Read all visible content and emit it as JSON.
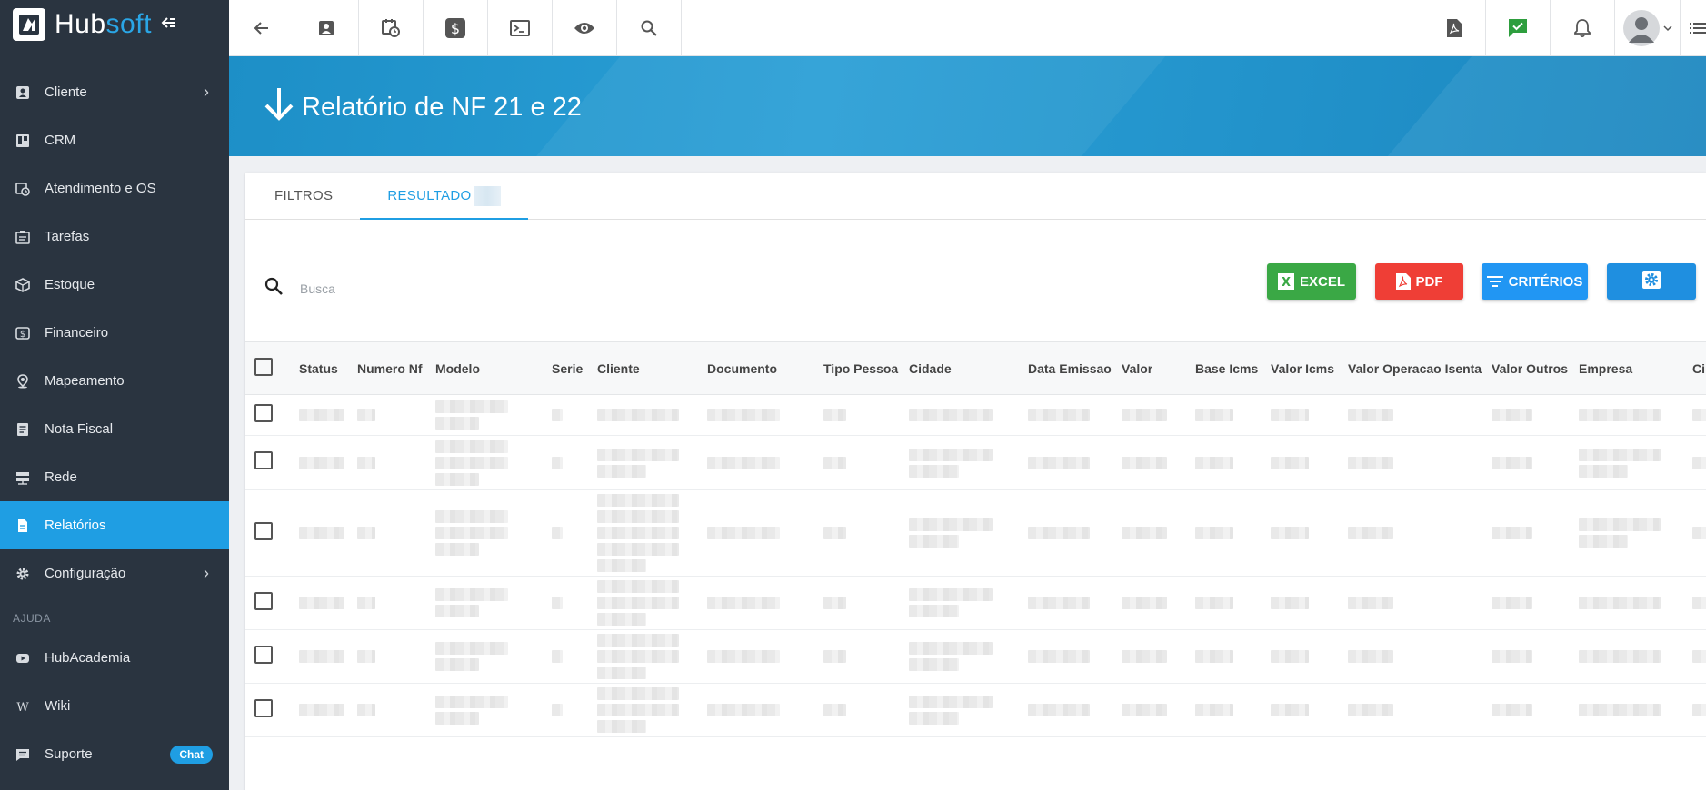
{
  "brand": {
    "part1": "Hub",
    "part2": "soft"
  },
  "sidebar": {
    "items": [
      {
        "label": "Cliente",
        "icon": "contact-card-icon",
        "chevron": true
      },
      {
        "label": "CRM",
        "icon": "kanban-icon",
        "chevron": false
      },
      {
        "label": "Atendimento e OS",
        "icon": "calendar-clock-icon",
        "chevron": false
      },
      {
        "label": "Tarefas",
        "icon": "task-board-icon",
        "chevron": false
      },
      {
        "label": "Estoque",
        "icon": "box-icon",
        "chevron": false
      },
      {
        "label": "Financeiro",
        "icon": "dollar-icon",
        "chevron": false
      },
      {
        "label": "Mapeamento",
        "icon": "map-pin-icon",
        "chevron": false
      },
      {
        "label": "Nota Fiscal",
        "icon": "receipt-icon",
        "chevron": false
      },
      {
        "label": "Rede",
        "icon": "server-icon",
        "chevron": false
      },
      {
        "label": "Relatórios",
        "icon": "document-icon",
        "chevron": false,
        "active": true
      },
      {
        "label": "Configuração",
        "icon": "gear-icon",
        "chevron": true
      }
    ],
    "section_label": "AJUDA",
    "help_items": [
      {
        "label": "HubAcademia",
        "icon": "play-icon"
      },
      {
        "label": "Wiki",
        "icon": "wiki-icon"
      },
      {
        "label": "Suporte",
        "icon": "chat-bubble-icon",
        "badge": "Chat"
      }
    ]
  },
  "page": {
    "title": "Relatório de NF 21 e 22"
  },
  "tabs": [
    {
      "label": "FILTROS",
      "active": false
    },
    {
      "label": "RESULTADO",
      "active": true
    }
  ],
  "search": {
    "placeholder": "Busca",
    "value": ""
  },
  "actions": {
    "excel": "EXCEL",
    "pdf": "PDF",
    "criterios": "CRITÉRIOS"
  },
  "table": {
    "columns": [
      "Status",
      "Numero Nf",
      "Modelo",
      "Serie",
      "Cliente",
      "Documento",
      "Tipo Pessoa",
      "Cidade",
      "Data Emissao",
      "Valor",
      "Base Icms",
      "Valor Icms",
      "Valor Operacao Isenta",
      "Valor Outros",
      "Empresa",
      "Ci"
    ]
  },
  "colors": {
    "sidebar_bg": "#2a3440",
    "accent": "#1f9ee3",
    "excel": "#3aa845",
    "pdf": "#ef3e36",
    "criterios": "#2196f3"
  }
}
